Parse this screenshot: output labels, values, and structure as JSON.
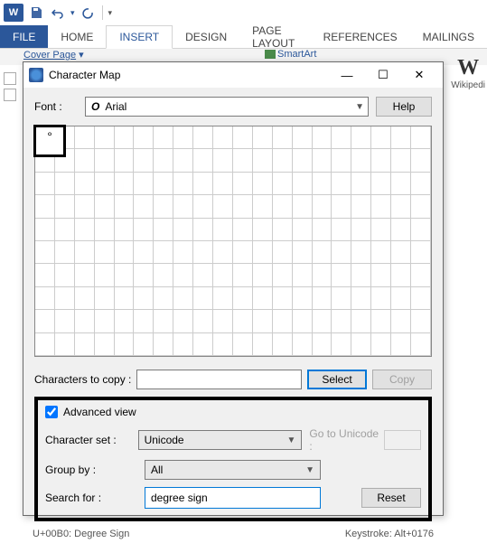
{
  "qat": {
    "word_badge": "W"
  },
  "ribbon": {
    "tabs": [
      "FILE",
      "HOME",
      "INSERT",
      "DESIGN",
      "PAGE LAYOUT",
      "REFERENCES",
      "MAILINGS"
    ],
    "active_index": 2,
    "cover_page": "Cover Page",
    "smartart": "SmartArt"
  },
  "wiki": {
    "letter": "W",
    "label": "Wikipedi"
  },
  "dialog": {
    "title": "Character Map",
    "font_label": "Font :",
    "font_prefix": "O",
    "font_value": "Arial",
    "help": "Help",
    "selected_char": "°",
    "copy_label": "Characters to copy :",
    "copy_value": "",
    "select_btn": "Select",
    "copy_btn": "Copy",
    "adv_label": "Advanced view",
    "adv_checked": true,
    "charset_label": "Character set :",
    "charset_value": "Unicode",
    "goto_label": "Go to Unicode :",
    "goto_value": "",
    "group_label": "Group by :",
    "group_value": "All",
    "search_label": "Search for :",
    "search_value": "degree sign",
    "reset": "Reset",
    "status_left": "U+00B0: Degree Sign",
    "status_right": "Keystroke: Alt+0176"
  }
}
